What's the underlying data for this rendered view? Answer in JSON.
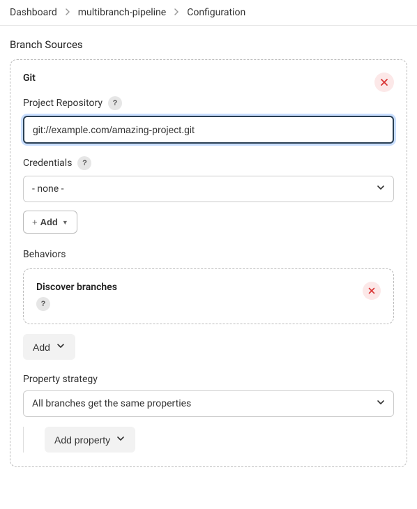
{
  "breadcrumb": {
    "items": [
      "Dashboard",
      "multibranch-pipeline",
      "Configuration"
    ]
  },
  "section": {
    "title": "Branch Sources"
  },
  "source": {
    "title": "Git",
    "repository": {
      "label": "Project Repository",
      "value": "git://example.com/amazing-project.git"
    },
    "credentials": {
      "label": "Credentials",
      "selected": "- none -"
    },
    "add_label": "Add",
    "behaviors": {
      "label": "Behaviors",
      "discover_label": "Discover branches",
      "add_label": "Add"
    },
    "property_strategy": {
      "label": "Property strategy",
      "selected": "All branches get the same properties",
      "add_property_label": "Add property"
    }
  },
  "help_glyph": "?"
}
